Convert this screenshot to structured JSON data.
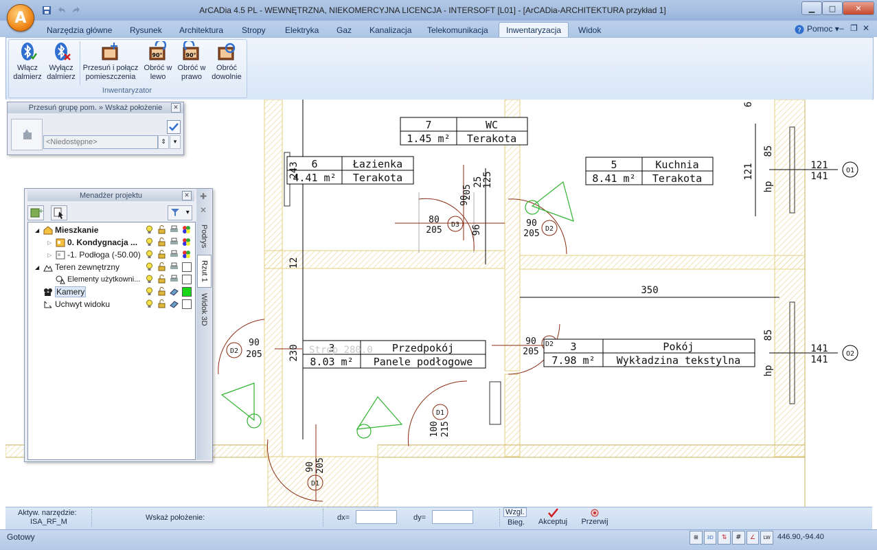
{
  "window": {
    "title": "ArCADia 4.5 PL - WEWNĘTRZNA, NIEKOMERCYJNA LICENCJA - INTERSOFT [L01] - [ArCADia-ARCHITEKTURA przykład 1]",
    "orb_letter": "A"
  },
  "tabs": [
    {
      "label": "Narzędzia główne"
    },
    {
      "label": "Rysunek"
    },
    {
      "label": "Architektura"
    },
    {
      "label": "Stropy"
    },
    {
      "label": "Elektryka"
    },
    {
      "label": "Gaz"
    },
    {
      "label": "Kanalizacja"
    },
    {
      "label": "Telekomunikacja"
    },
    {
      "label": "Inwentaryzacja"
    },
    {
      "label": "Widok"
    }
  ],
  "active_tab": "Inwentaryzacja",
  "help": {
    "label": "Pomoc"
  },
  "ribbon": {
    "group_label": "Inwentaryzator",
    "buttons": [
      {
        "line1": "Włącz",
        "line2": "dalmierz",
        "icon": "bluetooth-on-icon"
      },
      {
        "line1": "Wyłącz",
        "line2": "dalmierz",
        "icon": "bluetooth-off-icon"
      },
      {
        "line1": "Przesuń i połącz",
        "line2": "pomieszczenia",
        "icon": "move-merge-rooms-icon"
      },
      {
        "line1": "Obróć w",
        "line2": "lewo",
        "icon": "rotate-left-icon",
        "badge": "90°"
      },
      {
        "line1": "Obróć w",
        "line2": "prawo",
        "icon": "rotate-right-icon",
        "badge": "90°"
      },
      {
        "line1": "Obróć",
        "line2": "dowolnie",
        "icon": "rotate-free-icon"
      }
    ]
  },
  "move_panel": {
    "title": "Przesuń grupę pom. » Wskaż położenie",
    "dropdown_value": "<Niedostępne>"
  },
  "project_manager": {
    "title": "Menadżer projektu",
    "side_tabs": [
      "Podrys",
      "Rzut 1",
      "Widok 3D"
    ],
    "tree": [
      {
        "label": "Mieszkanie",
        "bold": true,
        "expander": "◢",
        "box": ""
      },
      {
        "label": "0. Kondygnacja ...",
        "bold": true,
        "expander": "▷",
        "box": ""
      },
      {
        "label": "-1. Podłoga (-50.00)",
        "bold": false,
        "expander": "▷",
        "box": ""
      },
      {
        "label": "Teren zewnętrzny",
        "bold": false,
        "expander": "◢",
        "box": "white"
      },
      {
        "label": "Elementy użytkowni...",
        "bold": false,
        "expander": "",
        "box": "white"
      },
      {
        "label": "Kamery",
        "bold": false,
        "expander": "",
        "box": "green"
      },
      {
        "label": "Uchwyt widoku",
        "bold": false,
        "expander": "",
        "box": "white"
      }
    ]
  },
  "drawing": {
    "rooms": [
      {
        "num": "7",
        "name": "WC",
        "area": "1.45 m²",
        "floor": "Terakota"
      },
      {
        "num": "6",
        "name": "Łazienka",
        "area": "4.41 m²",
        "floor": "Terakota"
      },
      {
        "num": "5",
        "name": "Kuchnia",
        "area": "8.41 m²",
        "floor": "Terakota"
      },
      {
        "num": "3",
        "name": "Przedpokój",
        "area": "8.03 m²",
        "floor": "Panele podłogowe"
      },
      {
        "num": "3",
        "name": "Pokój",
        "area": "7.98 m²",
        "floor": "Wykładzina tekstylna"
      }
    ],
    "ghost_text": "Strop 280.0",
    "dims": [
      "350",
      "121",
      "85",
      "hp",
      "121",
      "141",
      "141",
      "141",
      "85",
      "hp",
      "96",
      "25",
      "125",
      "243",
      "230",
      "12",
      "6"
    ],
    "door_labels": [
      {
        "code": "D2",
        "a": "90",
        "b": "205"
      },
      {
        "code": "D3",
        "a": "80",
        "b": "205"
      },
      {
        "code": "D2",
        "a": "90",
        "b": "205"
      },
      {
        "code": "D2",
        "a": "90",
        "b": "205"
      },
      {
        "code": "D1",
        "a": "100",
        "b": "215"
      },
      {
        "code": "D1",
        "a": "90",
        "b": "205"
      },
      {
        "code": "D1",
        "a": "90",
        "b": "205"
      },
      {
        "code": "D1",
        "a": "",
        "b": ""
      },
      {
        "code": "D2",
        "a": "",
        "b": ""
      }
    ],
    "window_codes": [
      "O1",
      "O2"
    ]
  },
  "command_bar": {
    "active_tool_label": "Aktyw. narzędzie:",
    "active_tool_value": "ISA_RF_M",
    "prompt": "Wskaż położenie:",
    "dx_label": "dx=",
    "dy_label": "dy=",
    "dx_value": "",
    "dy_value": "",
    "toggle_top": "Wzgl.",
    "toggle_bottom": "Bieg.",
    "accept": "Akceptuj",
    "cancel": "Przerwij"
  },
  "status": {
    "text": "Gotowy",
    "coords": "446.90,-94.40"
  },
  "colors": {
    "accent": "#2f6fd0",
    "wall": "#e7d48a",
    "camera": "#2fb52f",
    "door": "#8a2b12"
  }
}
